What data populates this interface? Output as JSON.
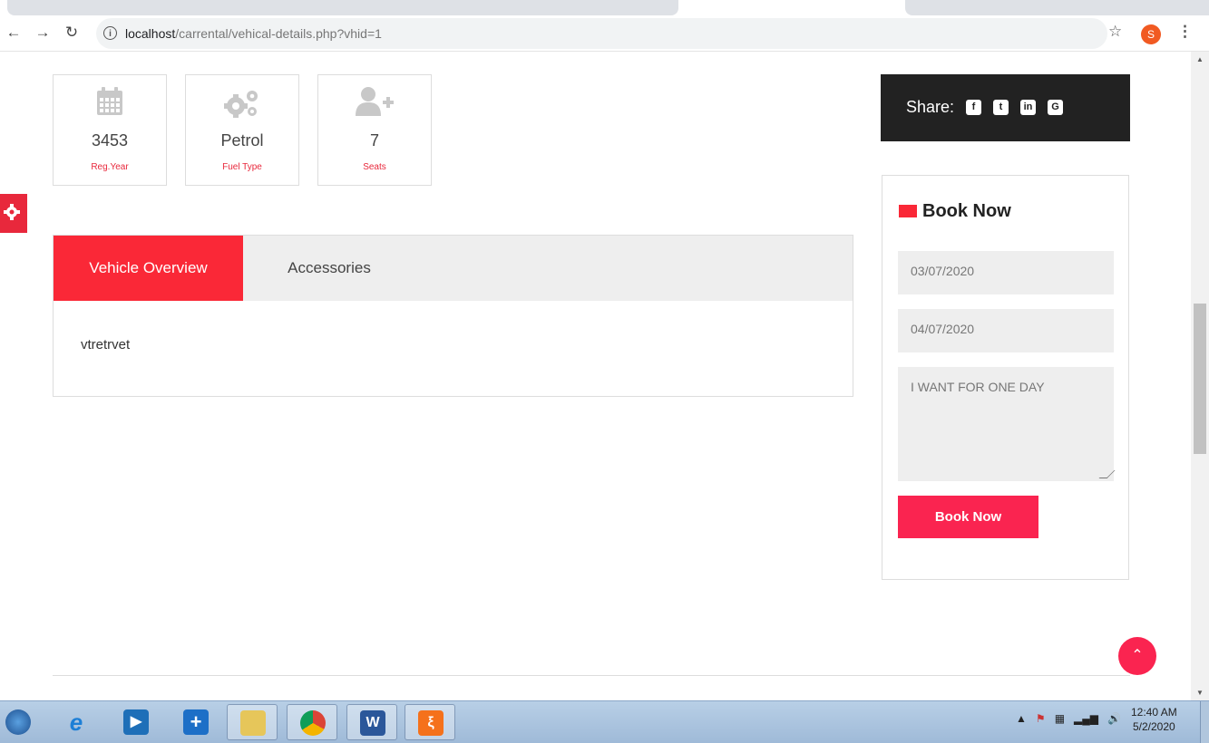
{
  "browser": {
    "url_host": "localhost",
    "url_path": "/carrental/vehical-details.php?vhid=1",
    "avatar_letter": "S"
  },
  "specs": [
    {
      "icon": "calendar-icon",
      "value": "3453",
      "label": "Reg.Year"
    },
    {
      "icon": "gears-icon",
      "value": "Petrol",
      "label": "Fuel Type"
    },
    {
      "icon": "user-plus-icon",
      "value": "7",
      "label": "Seats"
    }
  ],
  "tabs": {
    "overview_label": "Vehicle Overview",
    "accessories_label": "Accessories",
    "overview_text": "vtretrvet"
  },
  "share": {
    "label": "Share:",
    "icons": [
      "facebook-icon",
      "twitter-icon",
      "linkedin-icon",
      "google-plus-icon"
    ]
  },
  "booking": {
    "title": "Book Now",
    "from_date": "03/07/2020",
    "to_date": "04/07/2020",
    "message": "I WANT FOR ONE DAY",
    "submit_label": "Book Now"
  },
  "taskbar": {
    "time": "12:40 AM",
    "date": "5/2/2020"
  },
  "colors": {
    "accent": "#fa2837",
    "button": "#fa2450",
    "share_bg": "#222222"
  }
}
